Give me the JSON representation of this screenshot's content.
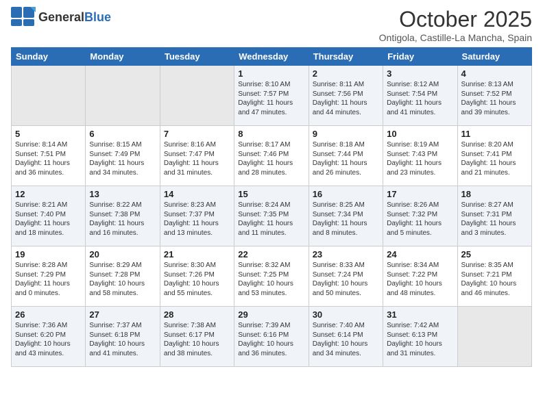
{
  "header": {
    "logo_general": "General",
    "logo_blue": "Blue",
    "title": "October 2025",
    "location": "Ontigola, Castille-La Mancha, Spain"
  },
  "weekdays": [
    "Sunday",
    "Monday",
    "Tuesday",
    "Wednesday",
    "Thursday",
    "Friday",
    "Saturday"
  ],
  "weeks": [
    [
      {
        "day": "",
        "info": ""
      },
      {
        "day": "",
        "info": ""
      },
      {
        "day": "",
        "info": ""
      },
      {
        "day": "1",
        "info": "Sunrise: 8:10 AM\nSunset: 7:57 PM\nDaylight: 11 hours\nand 47 minutes."
      },
      {
        "day": "2",
        "info": "Sunrise: 8:11 AM\nSunset: 7:56 PM\nDaylight: 11 hours\nand 44 minutes."
      },
      {
        "day": "3",
        "info": "Sunrise: 8:12 AM\nSunset: 7:54 PM\nDaylight: 11 hours\nand 41 minutes."
      },
      {
        "day": "4",
        "info": "Sunrise: 8:13 AM\nSunset: 7:52 PM\nDaylight: 11 hours\nand 39 minutes."
      }
    ],
    [
      {
        "day": "5",
        "info": "Sunrise: 8:14 AM\nSunset: 7:51 PM\nDaylight: 11 hours\nand 36 minutes."
      },
      {
        "day": "6",
        "info": "Sunrise: 8:15 AM\nSunset: 7:49 PM\nDaylight: 11 hours\nand 34 minutes."
      },
      {
        "day": "7",
        "info": "Sunrise: 8:16 AM\nSunset: 7:47 PM\nDaylight: 11 hours\nand 31 minutes."
      },
      {
        "day": "8",
        "info": "Sunrise: 8:17 AM\nSunset: 7:46 PM\nDaylight: 11 hours\nand 28 minutes."
      },
      {
        "day": "9",
        "info": "Sunrise: 8:18 AM\nSunset: 7:44 PM\nDaylight: 11 hours\nand 26 minutes."
      },
      {
        "day": "10",
        "info": "Sunrise: 8:19 AM\nSunset: 7:43 PM\nDaylight: 11 hours\nand 23 minutes."
      },
      {
        "day": "11",
        "info": "Sunrise: 8:20 AM\nSunset: 7:41 PM\nDaylight: 11 hours\nand 21 minutes."
      }
    ],
    [
      {
        "day": "12",
        "info": "Sunrise: 8:21 AM\nSunset: 7:40 PM\nDaylight: 11 hours\nand 18 minutes."
      },
      {
        "day": "13",
        "info": "Sunrise: 8:22 AM\nSunset: 7:38 PM\nDaylight: 11 hours\nand 16 minutes."
      },
      {
        "day": "14",
        "info": "Sunrise: 8:23 AM\nSunset: 7:37 PM\nDaylight: 11 hours\nand 13 minutes."
      },
      {
        "day": "15",
        "info": "Sunrise: 8:24 AM\nSunset: 7:35 PM\nDaylight: 11 hours\nand 11 minutes."
      },
      {
        "day": "16",
        "info": "Sunrise: 8:25 AM\nSunset: 7:34 PM\nDaylight: 11 hours\nand 8 minutes."
      },
      {
        "day": "17",
        "info": "Sunrise: 8:26 AM\nSunset: 7:32 PM\nDaylight: 11 hours\nand 5 minutes."
      },
      {
        "day": "18",
        "info": "Sunrise: 8:27 AM\nSunset: 7:31 PM\nDaylight: 11 hours\nand 3 minutes."
      }
    ],
    [
      {
        "day": "19",
        "info": "Sunrise: 8:28 AM\nSunset: 7:29 PM\nDaylight: 11 hours\nand 0 minutes."
      },
      {
        "day": "20",
        "info": "Sunrise: 8:29 AM\nSunset: 7:28 PM\nDaylight: 10 hours\nand 58 minutes."
      },
      {
        "day": "21",
        "info": "Sunrise: 8:30 AM\nSunset: 7:26 PM\nDaylight: 10 hours\nand 55 minutes."
      },
      {
        "day": "22",
        "info": "Sunrise: 8:32 AM\nSunset: 7:25 PM\nDaylight: 10 hours\nand 53 minutes."
      },
      {
        "day": "23",
        "info": "Sunrise: 8:33 AM\nSunset: 7:24 PM\nDaylight: 10 hours\nand 50 minutes."
      },
      {
        "day": "24",
        "info": "Sunrise: 8:34 AM\nSunset: 7:22 PM\nDaylight: 10 hours\nand 48 minutes."
      },
      {
        "day": "25",
        "info": "Sunrise: 8:35 AM\nSunset: 7:21 PM\nDaylight: 10 hours\nand 46 minutes."
      }
    ],
    [
      {
        "day": "26",
        "info": "Sunrise: 7:36 AM\nSunset: 6:20 PM\nDaylight: 10 hours\nand 43 minutes."
      },
      {
        "day": "27",
        "info": "Sunrise: 7:37 AM\nSunset: 6:18 PM\nDaylight: 10 hours\nand 41 minutes."
      },
      {
        "day": "28",
        "info": "Sunrise: 7:38 AM\nSunset: 6:17 PM\nDaylight: 10 hours\nand 38 minutes."
      },
      {
        "day": "29",
        "info": "Sunrise: 7:39 AM\nSunset: 6:16 PM\nDaylight: 10 hours\nand 36 minutes."
      },
      {
        "day": "30",
        "info": "Sunrise: 7:40 AM\nSunset: 6:14 PM\nDaylight: 10 hours\nand 34 minutes."
      },
      {
        "day": "31",
        "info": "Sunrise: 7:42 AM\nSunset: 6:13 PM\nDaylight: 10 hours\nand 31 minutes."
      },
      {
        "day": "",
        "info": ""
      }
    ]
  ]
}
